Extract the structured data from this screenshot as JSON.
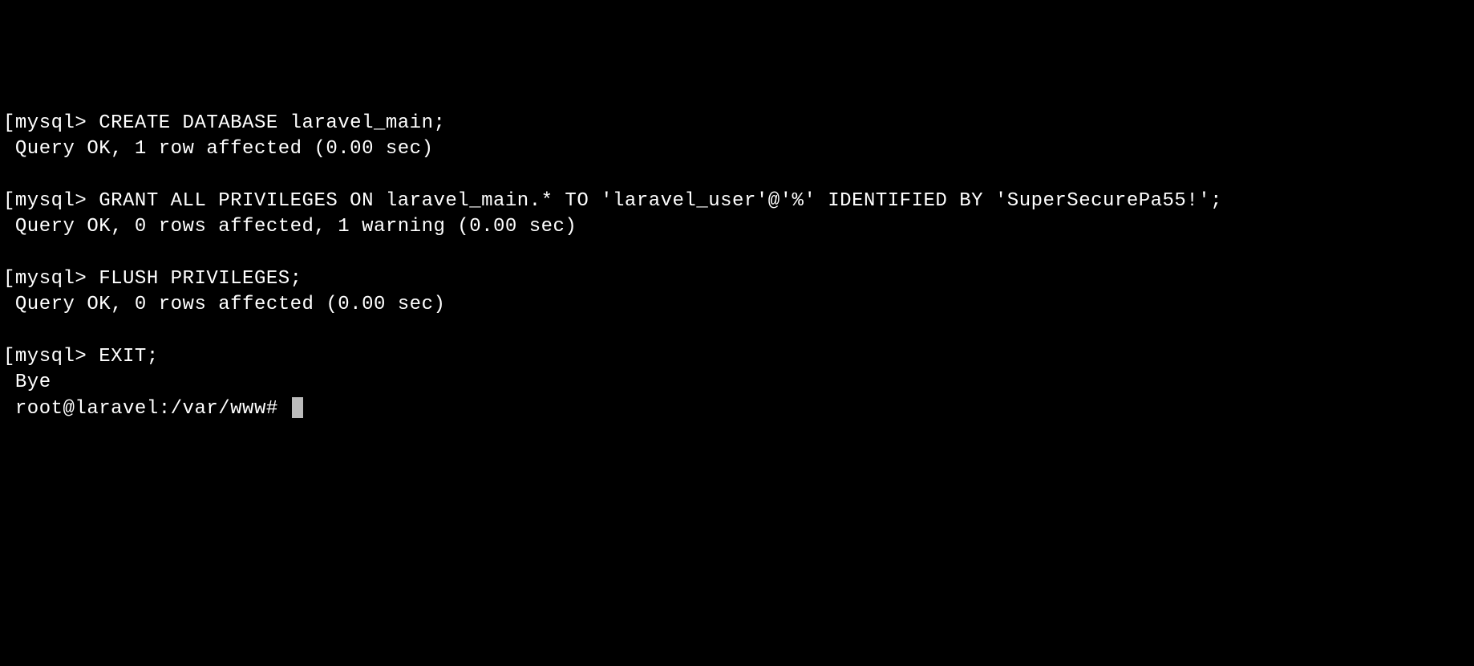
{
  "lines": [
    {
      "text": "[mysql> CREATE DATABASE laravel_main;",
      "type": "command"
    },
    {
      "text": " Query OK, 1 row affected (0.00 sec)",
      "type": "output"
    },
    {
      "text": "",
      "type": "blank"
    },
    {
      "text": "[mysql> GRANT ALL PRIVILEGES ON laravel_main.* TO 'laravel_user'@'%' IDENTIFIED BY 'SuperSecurePa55!';",
      "type": "command"
    },
    {
      "text": " Query OK, 0 rows affected, 1 warning (0.00 sec)",
      "type": "output"
    },
    {
      "text": "",
      "type": "blank"
    },
    {
      "text": "[mysql> FLUSH PRIVILEGES;",
      "type": "command"
    },
    {
      "text": " Query OK, 0 rows affected (0.00 sec)",
      "type": "output"
    },
    {
      "text": "",
      "type": "blank"
    },
    {
      "text": "[mysql> EXIT;",
      "type": "command"
    },
    {
      "text": " Bye",
      "type": "output"
    }
  ],
  "prompt": " root@laravel:/var/www# "
}
